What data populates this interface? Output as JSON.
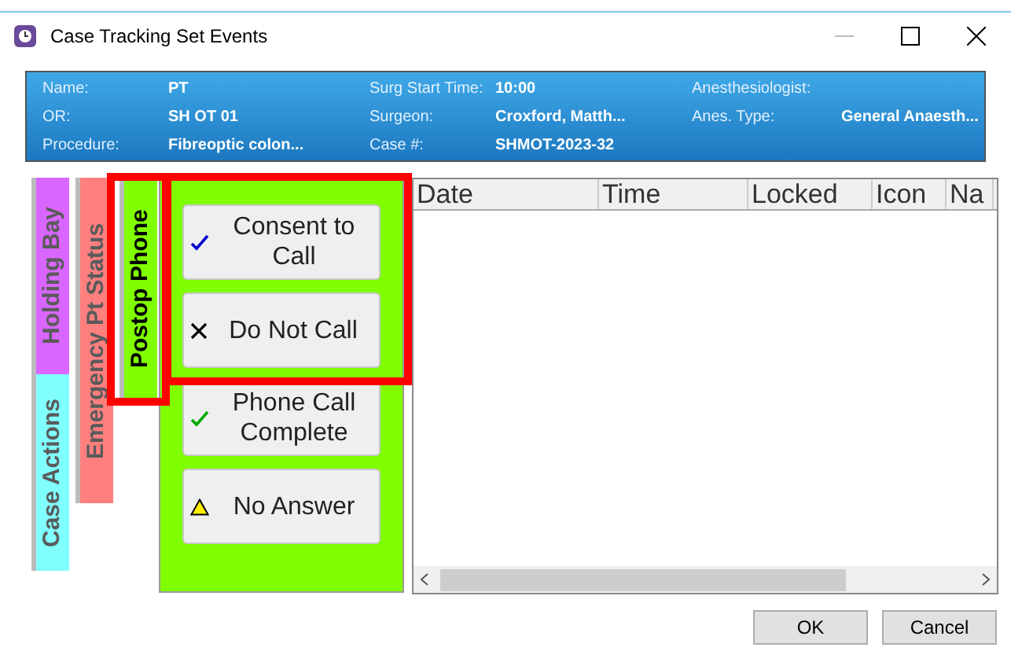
{
  "window": {
    "title": "Case Tracking Set Events"
  },
  "info": [
    {
      "label": "Name:",
      "value": "PT"
    },
    {
      "label": "Surg Start Time:",
      "value": "10:00"
    },
    {
      "label": "Anesthesiologist:"
    },
    {
      "label": "OR:",
      "value": "SH OT 01"
    },
    {
      "label": "Surgeon:",
      "value": "Croxford, Matth..."
    },
    {
      "label": "Anes. Type:",
      "value": "General Anaesth..."
    },
    {
      "label": "Procedure:",
      "value": "Fibreoptic colon..."
    },
    {
      "label": "Case #:",
      "value": "SHMOT-2023-32"
    }
  ],
  "tab_stacks": [
    {
      "tabs": [
        {
          "label": "Holding Bay",
          "color": "#d966ff",
          "selected": false
        },
        {
          "label": "Case Actions",
          "color": "#80ffff",
          "selected": false
        }
      ]
    },
    {
      "tabs": [
        {
          "label": "Emergency Pt Status",
          "color": "#ff7f7f",
          "selected": false
        }
      ]
    },
    {
      "tabs": [
        {
          "label": "Postop Phone",
          "color": "#80ff00",
          "selected": true
        }
      ]
    }
  ],
  "actions": [
    {
      "label": "Consent to Call",
      "kind": "check",
      "color": "#0000cc"
    },
    {
      "label": "Do Not Call",
      "kind": "cross"
    },
    {
      "label": "Phone Call Complete",
      "kind": "check",
      "color": "#00aa00"
    },
    {
      "label": "No Answer",
      "kind": "warning"
    }
  ],
  "table": {
    "columns": [
      "Date",
      "Time",
      "Locked",
      "Icon",
      "Na"
    ]
  },
  "buttons": [
    "OK",
    "Cancel"
  ]
}
